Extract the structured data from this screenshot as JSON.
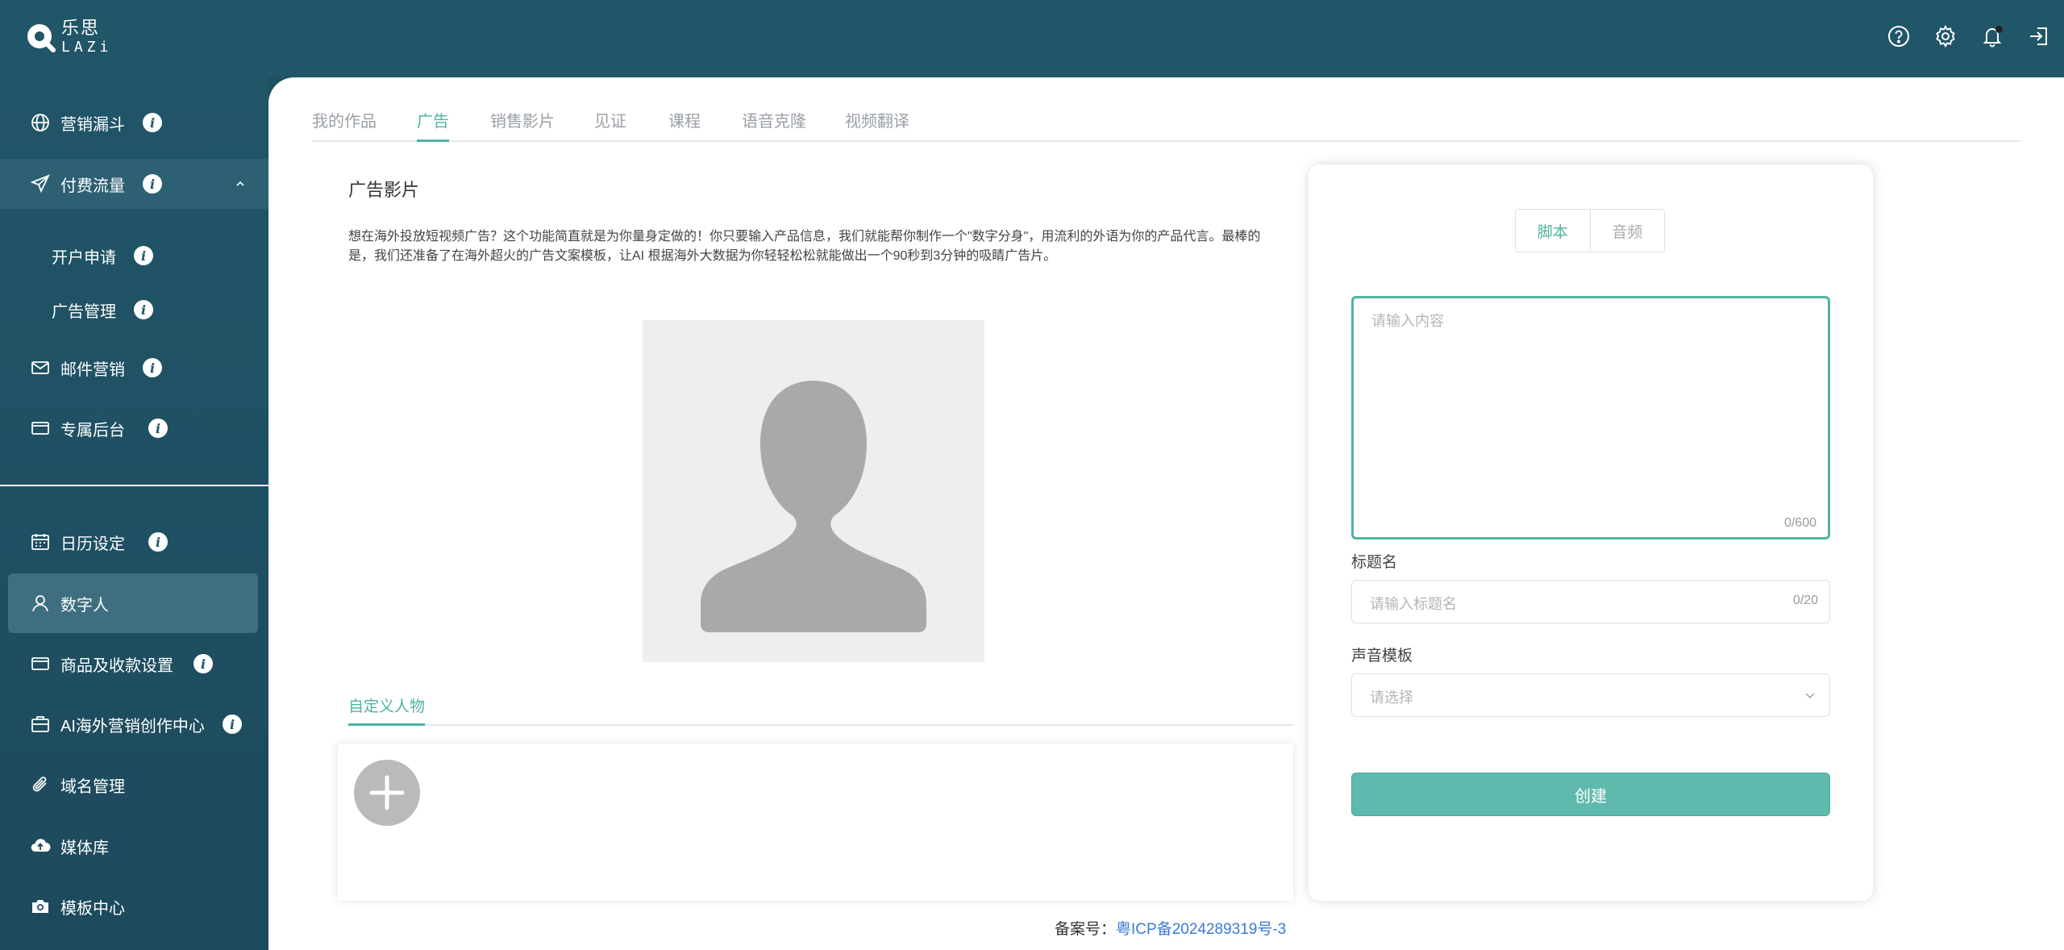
{
  "brand": {
    "name_cn": "乐思",
    "name_en": "LAZi"
  },
  "topbar": {
    "icons": [
      "help-icon",
      "settings-icon",
      "bell-icon",
      "logout-icon"
    ]
  },
  "sidebar": {
    "items": [
      {
        "label": "营销漏斗",
        "icon": "globe-icon"
      },
      {
        "label": "付费流量",
        "icon": "paper-plane-icon"
      },
      {
        "label": "开户申请"
      },
      {
        "label": "广告管理"
      },
      {
        "label": "邮件营销",
        "icon": "mail-icon"
      },
      {
        "label": "专属后台",
        "icon": "card-icon"
      },
      {
        "label": "日历设定",
        "icon": "calendar-icon"
      },
      {
        "label": "数字人",
        "icon": "user-icon"
      },
      {
        "label": "商品及收款设置",
        "icon": "card-icon"
      },
      {
        "label": "AI海外营销创作中心",
        "icon": "briefcase-icon"
      },
      {
        "label": "域名管理",
        "icon": "paperclip-icon"
      },
      {
        "label": "媒体库",
        "icon": "cloud-upload-icon"
      },
      {
        "label": "模板中心",
        "icon": "camera-icon"
      }
    ]
  },
  "tabs": [
    "我的作品",
    "广告",
    "销售影片",
    "见证",
    "课程",
    "语音克隆",
    "视频翻译"
  ],
  "content": {
    "title": "广告影片",
    "description": "想在海外投放短视频广告？这个功能简直就是为你量身定做的！你只要输入产品信息，我们就能帮你制作一个\"数字分身\"，用流利的外语为你的产品代言。最棒的是，我们还准备了在海外超火的广告文案模板，让AI 根据海外大数据为你轻轻松松就能做出一个90秒到3分钟的吸睛广告片。",
    "custom_tab": "自定义人物"
  },
  "form": {
    "segments": [
      "脚本",
      "音频"
    ],
    "content_placeholder": "请输入内容",
    "content_count": "0/600",
    "title_label": "标题名",
    "title_placeholder": "请输入标题名",
    "title_count": "0/20",
    "voice_label": "声音模板",
    "voice_placeholder": "请选择",
    "create_label": "创建"
  },
  "footer": {
    "prefix": "备案号：",
    "icp": "粤ICP备2024289319号-3"
  },
  "colors": {
    "accent": "#4db3a2",
    "sidebar": "#215568",
    "button": "#5fbaad"
  }
}
